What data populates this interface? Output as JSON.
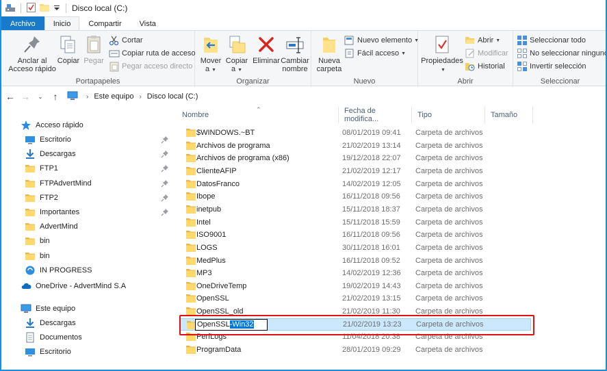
{
  "window": {
    "title": "Disco local (C:)"
  },
  "tabs": [
    {
      "label": "Archivo"
    },
    {
      "label": "Inicio"
    },
    {
      "label": "Compartir"
    },
    {
      "label": "Vista"
    }
  ],
  "ribbon": {
    "portapapeles": {
      "label": "Portapapeles",
      "pin_label_1": "Anclar al",
      "pin_label_2": "Acceso rápido",
      "copy": "Copiar",
      "paste": "Pegar",
      "cut": "Cortar",
      "copy_path": "Copiar ruta de acceso",
      "paste_shortcut": "Pegar acceso directo"
    },
    "organizar": {
      "label": "Organizar",
      "move_1": "Mover",
      "move_2": "a",
      "copyto_1": "Copiar",
      "copyto_2": "a",
      "delete": "Eliminar",
      "rename_1": "Cambiar",
      "rename_2": "nombre"
    },
    "nuevo": {
      "label": "Nuevo",
      "newfolder_1": "Nueva",
      "newfolder_2": "carpeta",
      "new_item": "Nuevo elemento",
      "easy_access": "Fácil acceso"
    },
    "abrir": {
      "label": "Abrir",
      "properties": "Propiedades",
      "open": "Abrir",
      "edit": "Modificar",
      "history": "Historial"
    },
    "seleccionar": {
      "label": "Seleccionar",
      "select_all": "Seleccionar todo",
      "select_none": "No seleccionar ninguno",
      "invert": "Invertir selección"
    }
  },
  "address": {
    "crumbs": [
      "Este equipo",
      "Disco local (C:)"
    ]
  },
  "nav": {
    "quick_access": "Acceso rápido",
    "items": [
      {
        "label": "Escritorio",
        "icon": "desktop-icon",
        "pinned": true
      },
      {
        "label": "Descargas",
        "icon": "downloads-icon",
        "pinned": true
      },
      {
        "label": "FTP1",
        "icon": "folder-icon",
        "pinned": true
      },
      {
        "label": "FTPAdvertMind",
        "icon": "folder-icon",
        "pinned": true
      },
      {
        "label": "FTP2",
        "icon": "folder-icon",
        "pinned": true
      },
      {
        "label": "Importantes",
        "icon": "folder-icon",
        "pinned": true
      },
      {
        "label": "AdvertMind",
        "icon": "folder-icon",
        "pinned": false
      },
      {
        "label": "bin",
        "icon": "folder-icon",
        "pinned": false
      },
      {
        "label": "bin",
        "icon": "folder-icon",
        "pinned": false
      },
      {
        "label": "IN PROGRESS",
        "icon": "sync-icon",
        "pinned": false
      }
    ],
    "onedrive": "OneDrive - AdvertMind S.A",
    "this_pc": "Este equipo",
    "pc_items": [
      {
        "label": "Descargas",
        "icon": "downloads-icon"
      },
      {
        "label": "Documentos",
        "icon": "documents-icon"
      },
      {
        "label": "Escritorio",
        "icon": "desktop-icon"
      }
    ]
  },
  "columns": {
    "name": "Nombre",
    "date": "Fecha de modifica...",
    "type": "Tipo",
    "size": "Tamaño"
  },
  "files": [
    {
      "name": "$WINDOWS.~BT",
      "date": "08/01/2019 09:41",
      "type": "Carpeta de archivos"
    },
    {
      "name": "Archivos de programa",
      "date": "21/02/2019 13:14",
      "type": "Carpeta de archivos"
    },
    {
      "name": "Archivos de programa (x86)",
      "date": "19/12/2018 22:07",
      "type": "Carpeta de archivos"
    },
    {
      "name": "ClienteAFIP",
      "date": "21/02/2019 12:17",
      "type": "Carpeta de archivos"
    },
    {
      "name": "DatosFranco",
      "date": "14/02/2019 12:05",
      "type": "Carpeta de archivos"
    },
    {
      "name": "Ibope",
      "date": "16/11/2018 09:56",
      "type": "Carpeta de archivos"
    },
    {
      "name": "inetpub",
      "date": "15/11/2018 18:37",
      "type": "Carpeta de archivos"
    },
    {
      "name": "Intel",
      "date": "15/11/2018 15:59",
      "type": "Carpeta de archivos"
    },
    {
      "name": "ISO9001",
      "date": "16/11/2018 09:56",
      "type": "Carpeta de archivos"
    },
    {
      "name": "LOGS",
      "date": "30/11/2018 16:01",
      "type": "Carpeta de archivos"
    },
    {
      "name": "MedPlus",
      "date": "16/11/2018 09:52",
      "type": "Carpeta de archivos"
    },
    {
      "name": "MP3",
      "date": "14/02/2019 12:36",
      "type": "Carpeta de archivos"
    },
    {
      "name": "OneDriveTemp",
      "date": "19/02/2019 14:43",
      "type": "Carpeta de archivos"
    },
    {
      "name": "OpenSSL",
      "date": "21/02/2019 13:15",
      "type": "Carpeta de archivos"
    },
    {
      "name": "OpenSSL_old",
      "date": "21/02/2019 11:30",
      "type": "Carpeta de archivos"
    },
    {
      "name": "",
      "date": "21/02/2019 13:23",
      "type": "Carpeta de archivos"
    },
    {
      "name": "PerfLogs",
      "date": "11/04/2018 20:38",
      "type": "Carpeta de archivos"
    },
    {
      "name": "ProgramData",
      "date": "28/01/2019 09:29",
      "type": "Carpeta de archivos"
    }
  ],
  "rename": {
    "plain": "OpenSSL",
    "selected": "-Win32"
  }
}
